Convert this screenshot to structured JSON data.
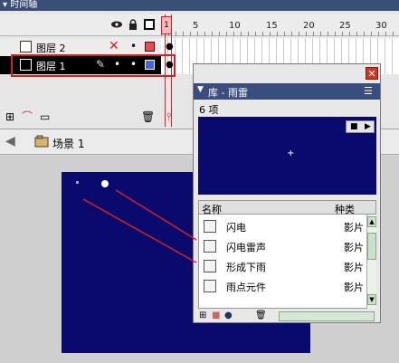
{
  "timeline": {
    "title": "时间轴",
    "frame_numbers": [
      "1",
      "5",
      "10",
      "15",
      "20",
      "25",
      "30"
    ],
    "current_frame": "1",
    "layers": [
      {
        "name": "图层 2"
      },
      {
        "name": "图层 1"
      }
    ]
  },
  "breadcrumb": {
    "scene": "场景 1"
  },
  "library": {
    "title": "库 - 雨雷",
    "count": "6 项",
    "columns": {
      "name": "名称",
      "kind": "种类"
    },
    "items": [
      {
        "name": "闪电",
        "kind": "影片"
      },
      {
        "name": "闪电雷声",
        "kind": "影片"
      },
      {
        "name": "形成下雨",
        "kind": "影片"
      },
      {
        "name": "雨点元件",
        "kind": "影片"
      }
    ]
  },
  "colors": {
    "stage_bg": "#0a0a6e",
    "annotation_red": "#d42020",
    "panel_title_bg": "#3a4e7d"
  }
}
